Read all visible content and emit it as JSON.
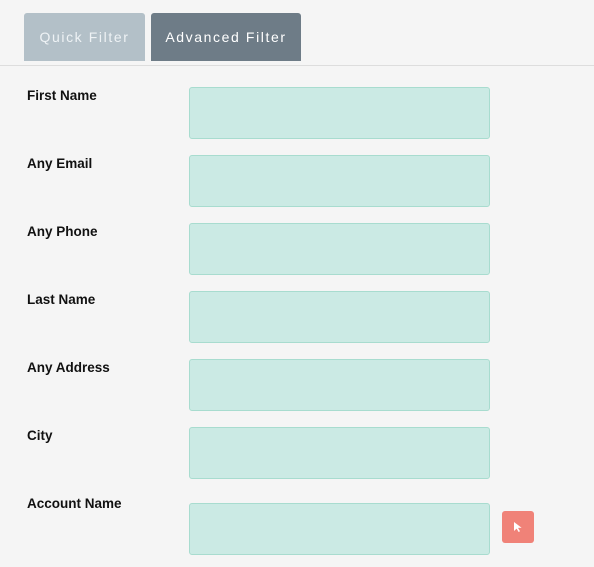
{
  "tabs": {
    "quick_filter": "Quick Filter",
    "advanced_filter": "Advanced Filter"
  },
  "fields": {
    "first_name": {
      "label": "First Name",
      "value": ""
    },
    "any_email": {
      "label": "Any Email",
      "value": ""
    },
    "any_phone": {
      "label": "Any Phone",
      "value": ""
    },
    "last_name": {
      "label": "Last Name",
      "value": ""
    },
    "any_address": {
      "label": "Any Address",
      "value": ""
    },
    "city": {
      "label": "City",
      "value": ""
    },
    "account_name": {
      "label": "Account Name",
      "value": ""
    }
  },
  "icons": {
    "account_select": "cursor-arrow-icon"
  },
  "colors": {
    "tab_inactive": "#b3c0c8",
    "tab_active": "#6e7c87",
    "input_bg": "#cbeae4",
    "input_border": "#a8dccf",
    "select_button": "#f08278",
    "background": "#f5f5f5"
  }
}
